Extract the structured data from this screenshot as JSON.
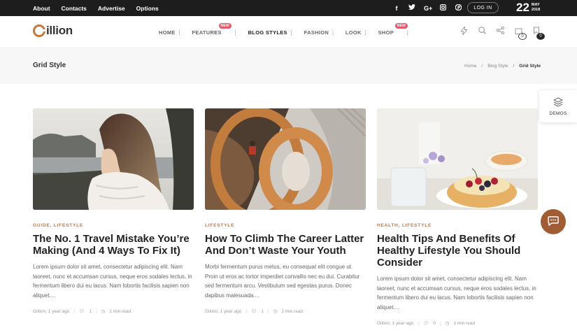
{
  "topbar": {
    "links": [
      "About",
      "Contacts",
      "Advertise",
      "Options"
    ],
    "social": [
      "f",
      "t",
      "G+",
      "ig",
      "p"
    ],
    "login": "LOG IN",
    "date_day": "22",
    "date_month": "MAY",
    "date_year": "2018"
  },
  "header": {
    "logo": "illion",
    "nav": [
      {
        "label": "HOME"
      },
      {
        "label": "FEATURES",
        "badge": "NEW"
      },
      {
        "label": "BLOG STYLES"
      },
      {
        "label": "FASHION"
      },
      {
        "label": "LOOK"
      },
      {
        "label": "SHOP",
        "badge": "NEW"
      }
    ],
    "cart_count": "0",
    "bookmark_count": "0"
  },
  "page": {
    "title": "Grid Style",
    "breadcrumb": [
      "Home",
      "/",
      "Blog Style",
      "/",
      "Grid Style"
    ]
  },
  "posts": [
    {
      "category": "GUIDE, LIFESTYLE",
      "title": "The No. 1 Travel Mistake You’re Making (And 4 Ways To Fix It)",
      "excerpt": "Lorem ipsum dolor sit amet, consectetur adipiscing elit. Nam laoreet, nunc et accumsan cursus, neque eros sodales lectus, in fermentum libero dui eu lacus. Nam lobortis facilisis sapien non aliquet....",
      "author": "Gillion, 1 year ago",
      "comments": "1",
      "read": "1 min read"
    },
    {
      "category": "LIFESTYLE",
      "title": "How To Climb The Career Latter And Don’t Waste Your Youth",
      "excerpt": "Morbi fermentum purus metus, eu consequat elit congue ut. Proin ut eros ac tortor imperdiet convallis nec eu dui. Curabitur sed fermentum arcu. Vestibulum sed egestas purus. Donec dapibus malesuada....",
      "author": "Gillion, 1 year ago",
      "comments": "1",
      "read": "2 min read"
    },
    {
      "category": "HEALTH, LIFESTYLE",
      "title": "Health Tips And Benefits Of Healthy Lifestyle You Should Consider",
      "excerpt": "Lorem ipsum dolor sit amet, consectetur adipiscing elit. Nam laoreet, nunc et accumsan cursus, neque eros sodales lectus, in fermentum libero dui eu lacus. Nam lobortis facilisis sapien non aliquet....",
      "author": "Gillion, 1 year ago",
      "comments": "0",
      "read": "1 min read"
    }
  ],
  "widgets": {
    "demos_label": "DEMOS"
  },
  "colors": {
    "accent": "#c6763c",
    "badge": "#e45b6b",
    "topbar": "#1d1d1d"
  }
}
